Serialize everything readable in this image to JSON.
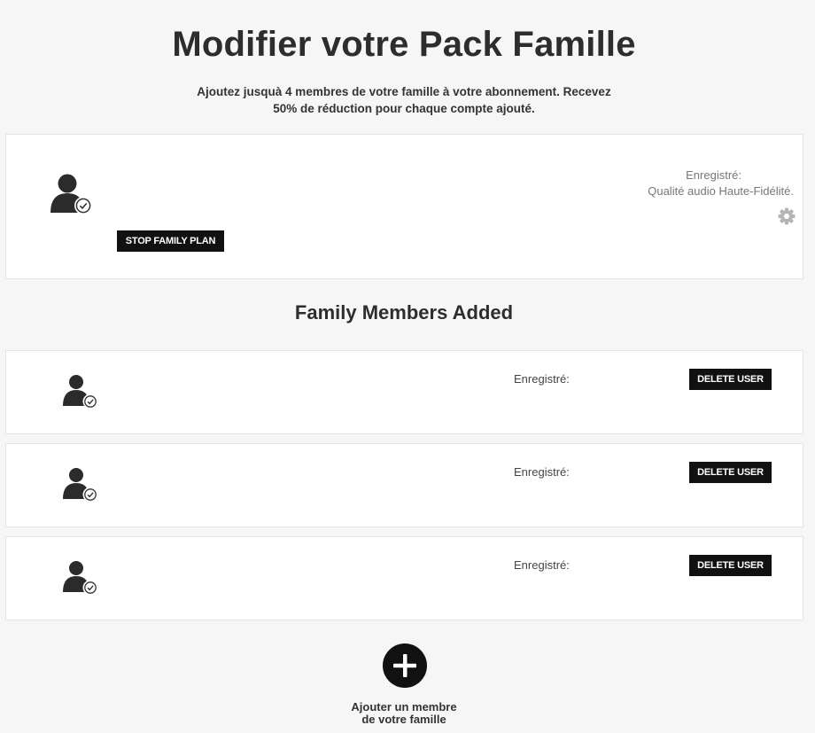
{
  "header": {
    "title": "Modifier votre Pack Famille",
    "subtitle_line1": "Ajoutez jusquà 4 membres de votre famille à votre abonnement. Recevez",
    "subtitle_line2": "50% de réduction pour chaque compte ajouté."
  },
  "owner": {
    "avatar_icon": "user-verified-icon",
    "stop_label": "STOP FAMILY PLAN",
    "registered_label": "Enregistré:",
    "quality_label": "Qualité audio Haute-Fidélité.",
    "settings_icon": "gear-icon"
  },
  "members_section": {
    "title": "Family Members Added"
  },
  "members": [
    {
      "registered_label": "Enregistré:",
      "delete_label": "DELETE USER"
    },
    {
      "registered_label": "Enregistré:",
      "delete_label": "DELETE USER"
    },
    {
      "registered_label": "Enregistré:",
      "delete_label": "DELETE USER"
    }
  ],
  "add_member": {
    "icon": "plus-icon",
    "label_line1": "Ajouter un membre",
    "label_line2": "de votre famille"
  },
  "colors": {
    "background": "#f6f6f6",
    "card": "#ffffff",
    "button": "#111111",
    "muted_text": "#777777"
  }
}
